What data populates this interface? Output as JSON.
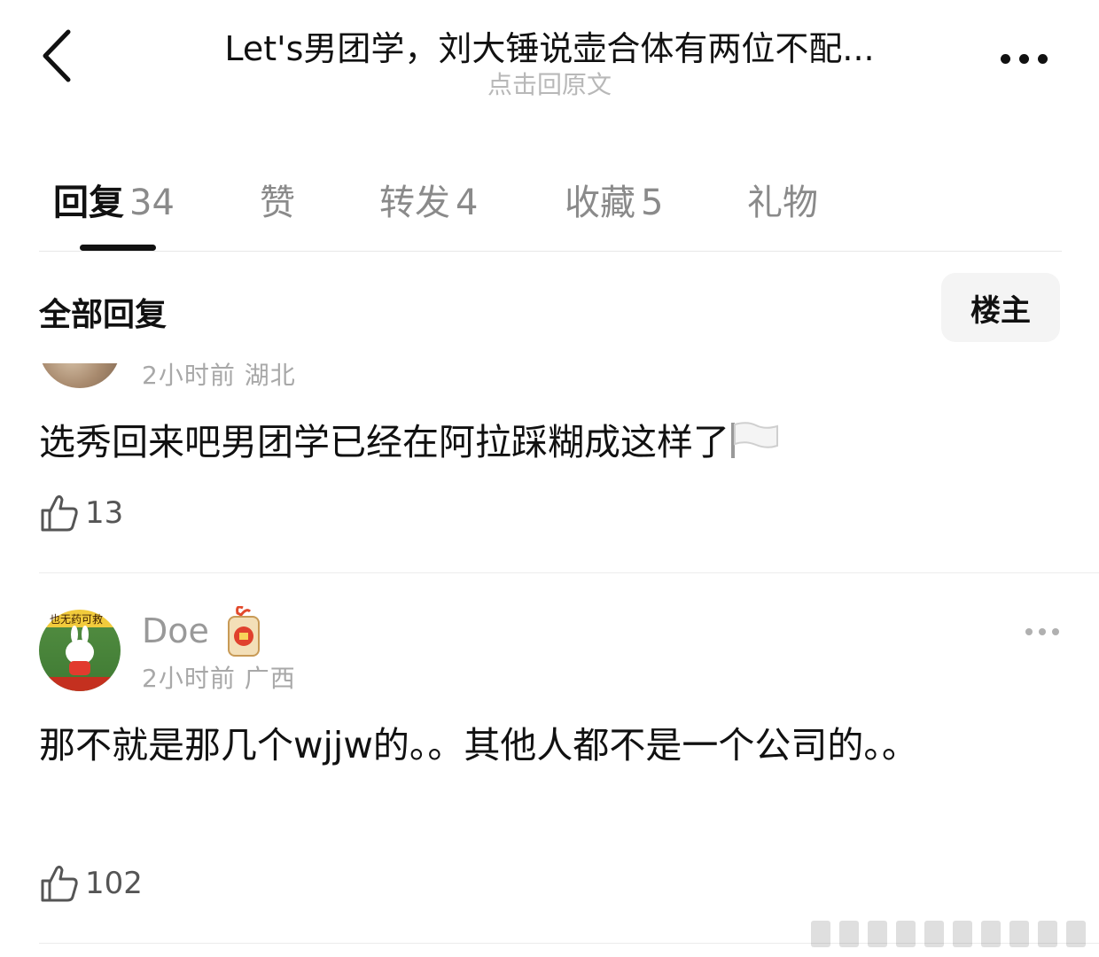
{
  "header": {
    "title": "Let's男团学，刘大锤说壶合体有两位不配...",
    "subtitle": "点击回原文",
    "back_icon": "chevron-left-icon",
    "more_icon": "more-horizontal-icon"
  },
  "tabs": [
    {
      "label": "回复",
      "count": "34",
      "active": true
    },
    {
      "label": "赞",
      "count": ""
    },
    {
      "label": "转发",
      "count": "4"
    },
    {
      "label": "收藏",
      "count": "5"
    },
    {
      "label": "礼物",
      "count": ""
    }
  ],
  "section": {
    "title": "全部回复",
    "op_filter": "楼主"
  },
  "comments": [
    {
      "meta": "2小时前  湖北",
      "text": "选秀回来吧男团学已经在阿拉踩糊成这样了",
      "emoji": "white-flag-icon",
      "likes": "13"
    },
    {
      "username": "Doe",
      "meta": "2小时前  广西",
      "text": "那不就是那几个wjjw的。。其他人都不是一个公司的。。",
      "likes": "102",
      "avatar_caption": "也无药可救"
    }
  ],
  "colors": {
    "text": "#111111",
    "muted": "#a8a8a8",
    "divider": "#ececec",
    "filter_bg": "#f4f4f4"
  }
}
